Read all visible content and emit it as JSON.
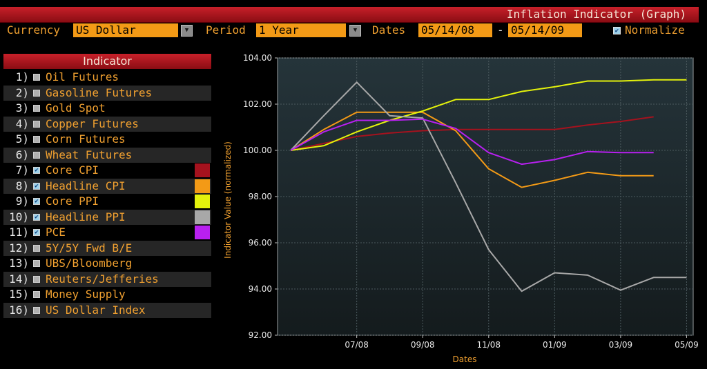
{
  "window": {
    "title": "Inflation Indicator (Graph)"
  },
  "controls": {
    "currency_label": "Currency",
    "currency_value": "US Dollar",
    "period_label": "Period",
    "period_value": "1 Year",
    "dates_label": "Dates",
    "date_from": "05/14/08",
    "date_sep": "-",
    "date_to": "05/14/09",
    "normalize_label": "Normalize",
    "normalize_checked": true
  },
  "indicator_panel": {
    "header": "Indicator",
    "items": [
      {
        "num": "1)",
        "label": "Oil Futures",
        "checked": false,
        "color": null
      },
      {
        "num": "2)",
        "label": "Gasoline Futures",
        "checked": false,
        "color": null
      },
      {
        "num": "3)",
        "label": "Gold Spot",
        "checked": false,
        "color": null
      },
      {
        "num": "4)",
        "label": "Copper Futures",
        "checked": false,
        "color": null
      },
      {
        "num": "5)",
        "label": "Corn Futures",
        "checked": false,
        "color": null
      },
      {
        "num": "6)",
        "label": "Wheat Futures",
        "checked": false,
        "color": null
      },
      {
        "num": "7)",
        "label": "Core CPI",
        "checked": true,
        "color": "#a5121e"
      },
      {
        "num": "8)",
        "label": "Headline CPI",
        "checked": true,
        "color": "#f39a16"
      },
      {
        "num": "9)",
        "label": "Core PPI",
        "checked": true,
        "color": "#e4f20c"
      },
      {
        "num": "10)",
        "label": "Headline PPI",
        "checked": true,
        "color": "#a8a8a8"
      },
      {
        "num": "11)",
        "label": "PCE",
        "checked": true,
        "color": "#b820f0"
      },
      {
        "num": "12)",
        "label": "5Y/5Y Fwd B/E",
        "checked": false,
        "color": null
      },
      {
        "num": "13)",
        "label": "UBS/Bloomberg",
        "checked": false,
        "color": null
      },
      {
        "num": "14)",
        "label": "Reuters/Jefferies",
        "checked": false,
        "color": null
      },
      {
        "num": "15)",
        "label": "Money Supply",
        "checked": false,
        "color": null
      },
      {
        "num": "16)",
        "label": "US Dollar Index",
        "checked": false,
        "color": null
      }
    ]
  },
  "chart_data": {
    "type": "line",
    "xlabel": "Dates",
    "ylabel": "Indicator Value (normalized)",
    "ylim": [
      92,
      104
    ],
    "yticks": [
      "92.00",
      "94.00",
      "96.00",
      "98.00",
      "100.00",
      "102.00",
      "104.00"
    ],
    "x_range": [
      -0.4,
      12.2
    ],
    "xticks": [
      {
        "label": "07/08",
        "x": 2
      },
      {
        "label": "09/08",
        "x": 4
      },
      {
        "label": "11/08",
        "x": 6
      },
      {
        "label": "01/09",
        "x": 8
      },
      {
        "label": "03/09",
        "x": 10
      },
      {
        "label": "05/09",
        "x": 12
      }
    ],
    "grid": true,
    "series": [
      {
        "color": "#a5121e",
        "x": [
          0,
          1,
          2,
          3,
          4,
          5,
          6,
          7,
          8,
          9,
          10,
          11
        ],
        "y": [
          100.0,
          100.3,
          100.6,
          100.75,
          100.85,
          100.9,
          100.9,
          100.9,
          100.9,
          101.1,
          101.25,
          101.45
        ]
      },
      {
        "color": "#f39a16",
        "x": [
          0,
          1,
          2,
          3,
          4,
          5,
          6,
          7,
          8,
          9,
          10,
          11
        ],
        "y": [
          100.0,
          100.9,
          101.65,
          101.65,
          101.65,
          100.85,
          99.2,
          98.4,
          98.7,
          99.05,
          98.9,
          98.9
        ]
      },
      {
        "color": "#e4f20c",
        "x": [
          0,
          1,
          2,
          3,
          4,
          5,
          6,
          7,
          8,
          9,
          10,
          11,
          12
        ],
        "y": [
          100.0,
          100.2,
          100.8,
          101.3,
          101.7,
          102.2,
          102.2,
          102.55,
          102.75,
          103.0,
          103.0,
          103.05,
          103.05
        ]
      },
      {
        "color": "#a8a8a8",
        "x": [
          0,
          1,
          2,
          3,
          4,
          5,
          6,
          7,
          8,
          9,
          10,
          11,
          12
        ],
        "y": [
          100.0,
          101.5,
          102.95,
          101.5,
          101.4,
          98.6,
          95.7,
          93.9,
          94.7,
          94.6,
          93.95,
          94.5,
          94.5
        ]
      },
      {
        "color": "#b820f0",
        "x": [
          0,
          1,
          2,
          3,
          4,
          5,
          6,
          7,
          8,
          9,
          10,
          11
        ],
        "y": [
          100.0,
          100.8,
          101.3,
          101.3,
          101.35,
          100.95,
          99.9,
          99.4,
          99.6,
          99.95,
          99.9,
          99.9
        ]
      }
    ]
  },
  "colors": {
    "title_bar": "#b01822",
    "accent_orange": "#f39a16",
    "plot_bg": "#1a2326"
  }
}
